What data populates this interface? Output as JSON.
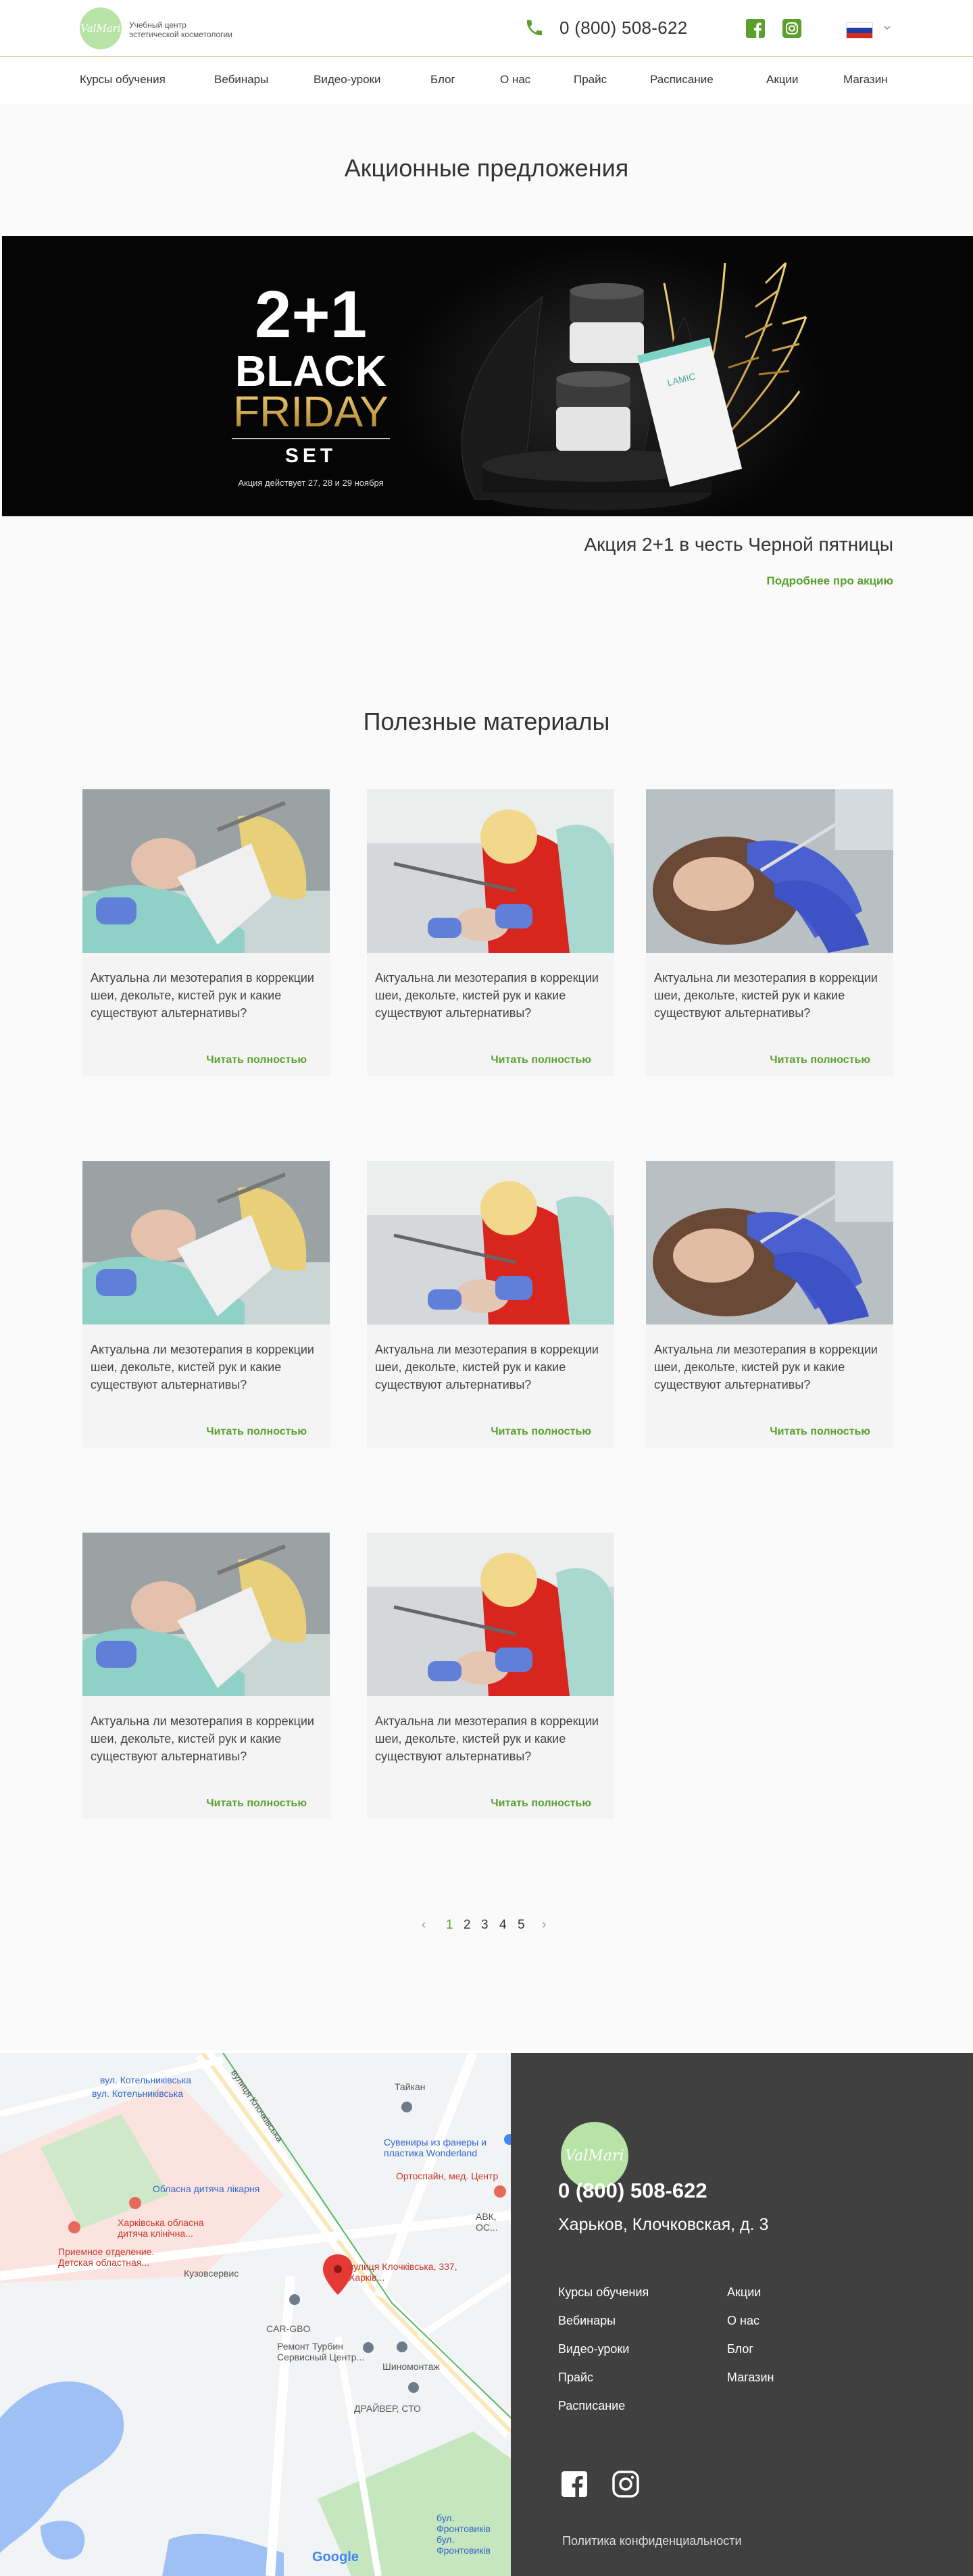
{
  "header": {
    "logo_text": "ValMari",
    "tagline_line1": "Учебный центр",
    "tagline_line2": "эстетической косметологии",
    "phone": "0 (800) 508-622",
    "language": "ru"
  },
  "nav": {
    "items": [
      {
        "label": "Курсы обучения"
      },
      {
        "label": "Вебинары"
      },
      {
        "label": "Видео-уроки"
      },
      {
        "label": "Блог"
      },
      {
        "label": "О нас"
      },
      {
        "label": "Прайс"
      },
      {
        "label": "Расписание"
      },
      {
        "label": "Акции"
      },
      {
        "label": "Магазин"
      }
    ]
  },
  "promo": {
    "section_title": "Акционные предложения",
    "banner": {
      "headline": "2+1",
      "line1": "BLACK",
      "line2": "FRIDAY",
      "line3": "SET",
      "dates": "Акция действует 27, 28 и 29 ноября",
      "product_brand": "LAMIC"
    },
    "caption": "Акция 2+1 в честь Черной пятницы",
    "link": "Подробнее про акцию"
  },
  "materials": {
    "section_title": "Полезные материалы",
    "cards": [
      {
        "text": "Актуальна ли мезотерапия в коррекции шеи, декольте, кистей рук и какие существуют альтернативы?",
        "link": "Читать полностью",
        "image": "cosmetology-procedure-photo-1"
      },
      {
        "text": "Актуальна ли мезотерапия в коррекции шеи, декольте, кистей рук и какие существуют альтернативы?",
        "link": "Читать полностью",
        "image": "cosmetology-procedure-photo-2"
      },
      {
        "text": "Актуальна ли мезотерапия в коррекции шеи, декольте, кистей рук и какие существуют альтернативы?",
        "link": "Читать полностью",
        "image": "cosmetology-procedure-photo-3"
      },
      {
        "text": "Актуальна ли мезотерапия в коррекции шеи, декольте, кистей рук и какие существуют альтернативы?",
        "link": "Читать полностью",
        "image": "cosmetology-procedure-photo-1"
      },
      {
        "text": "Актуальна ли мезотерапия в коррекции шеи, декольте, кистей рук и какие существуют альтернативы?",
        "link": "Читать полностью",
        "image": "cosmetology-procedure-photo-2"
      },
      {
        "text": "Актуальна ли мезотерапия в коррекции шеи, декольте, кистей рук и какие существуют альтернативы?",
        "link": "Читать полностью",
        "image": "cosmetology-procedure-photo-3"
      },
      {
        "text": "Актуальна ли мезотерапия в коррекции шеи, декольте, кистей рук и какие существуют альтернативы?",
        "link": "Читать полностью",
        "image": "cosmetology-procedure-photo-1"
      },
      {
        "text": "Актуальна ли мезотерапия в коррекции шеи, декольте, кистей рук и какие существуют альтернативы?",
        "link": "Читать полностью",
        "image": "cosmetology-procedure-photo-2"
      }
    ]
  },
  "pagination": {
    "prev": "‹",
    "next": "›",
    "pages": [
      "1",
      "2",
      "3",
      "4",
      "5"
    ],
    "current": "1"
  },
  "map": {
    "labels": {
      "street1": "вул. Котельниківська",
      "street2": "вул. Котельниківська",
      "street3": "вулиця Клочківська",
      "poi_hospital": "Обласна дитяча лікарня",
      "poi_kharkiv_hosp": "Харківська обласна дитяча клінічна...",
      "poi_reception": "Приемное отделение. Детская областная...",
      "poi_taikan": "Тайкан",
      "poi_souvenirs": "Сувениры из фанеры и пластика Wonderland",
      "poi_ortospain": "Ортоспайн, мед. Центр",
      "poi_abk": "АВК, ОС...",
      "poi_kuzov": "Кузовсервис",
      "poi_target": "вулиця Клочківська, 337, Харків...",
      "poi_cargbo": "CAR-GBO",
      "poi_turbin": "Ремонт Турбин Сервисный Центр...",
      "poi_tyres": "Шиномонтаж",
      "poi_driver": "ДРАЙВЕР, СТО",
      "poi_frontov": "бул. Фронтовиків бул. Фронтовиків",
      "google": "Google"
    }
  },
  "footer": {
    "logo_text": "ValMari",
    "phone": "0 (800) 508-622",
    "address": "Харьков, Клочковская, д. 3",
    "links_left": [
      "Курсы обучения",
      "Вебинары",
      "Видео-уроки",
      "Прайс",
      "Расписание"
    ],
    "links_right": [
      "Акции",
      "О нас",
      "Блог",
      "Магазин"
    ],
    "privacy": "Политика конфиденциальности"
  },
  "colors": {
    "accent_green": "#5aa02c",
    "logo_green": "#b7e4a6",
    "footer_bg": "#404040"
  }
}
